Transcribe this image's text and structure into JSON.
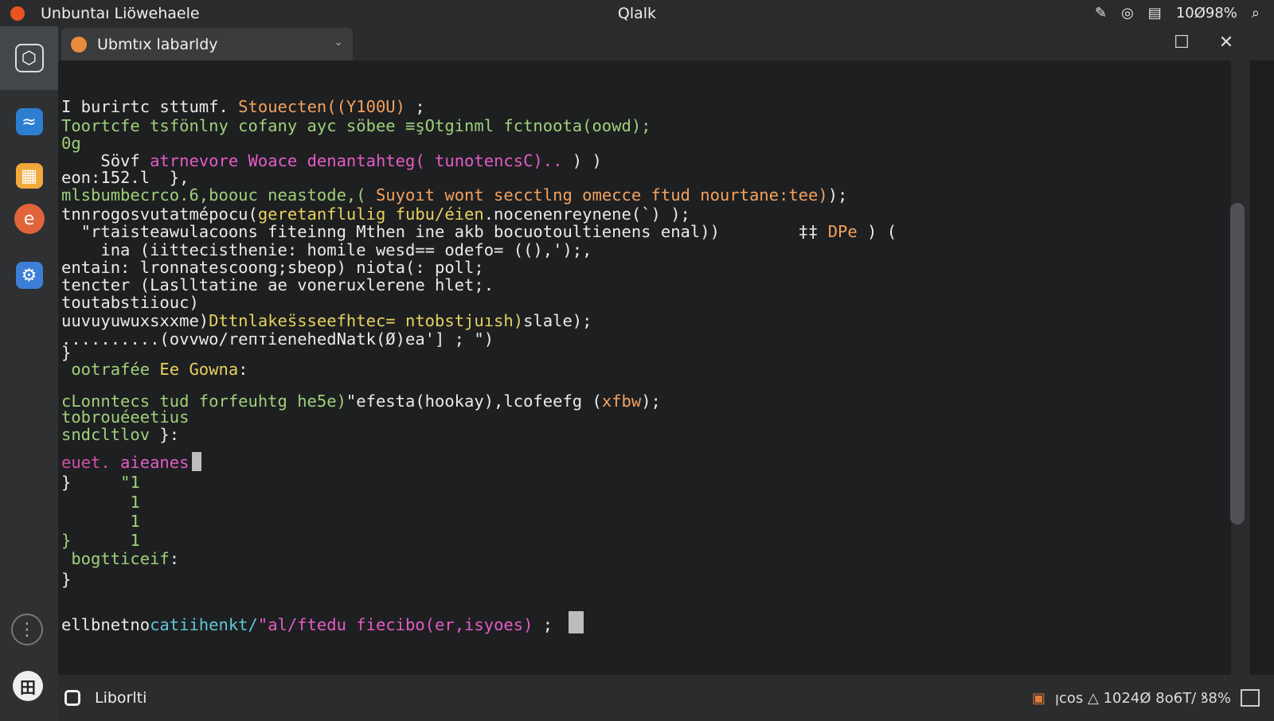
{
  "topbar": {
    "app_title": "Unbuntaı Liöwehaele",
    "clock": "Qlalk",
    "battery": "10Ø98%"
  },
  "tray_icons": [
    "edit-icon",
    "network-icon",
    "keyboard-icon",
    "search-icon"
  ],
  "dock": {
    "items": [
      "box-icon",
      "code-editor-icon",
      "files-icon",
      "browser-icon",
      "settings-icon"
    ],
    "more": "⋮",
    "apps": "田"
  },
  "window": {
    "tab_label": "Ubmtıx    labarldy",
    "maximize": "☐",
    "close": "✕"
  },
  "terminal": {
    "lines": [
      {
        "segs": [
          {
            "t": "I burirtc sttumf. ",
            "c": "#eaeaea"
          },
          {
            "t": "Stouecten((Y100U)",
            "c": "#f3a25e"
          },
          {
            "t": " ;",
            "c": "#eaeaea"
          }
        ]
      },
      {
        "segs": [
          {
            "t": "Toortcfe tsfönlny cofany ayc söbee ≡şOtginml fctnoota(oowd);",
            "c": "#9fd07a"
          }
        ]
      },
      {
        "segs": [
          {
            "t": "0g",
            "c": "#9fd07a"
          }
        ]
      },
      {
        "segs": [
          {
            "t": "    Sövf ",
            "c": "#eaeaea"
          },
          {
            "t": "atrnevore Woace denantahteg( tunotencsC)..",
            "c": "#e45cc4"
          },
          {
            "t": " ) )",
            "c": "#eaeaea"
          }
        ]
      },
      {
        "segs": [
          {
            "t": "eon:152.l  },",
            "c": "#eaeaea"
          }
        ]
      },
      {
        "segs": [
          {
            "t": "mlsbumbecrco.6,boouc neastode,( ",
            "c": "#9fd07a"
          },
          {
            "t": "Suyoıt wont secctlng omecce ftud nourtane:tee)",
            "c": "#f3a25e"
          },
          {
            "t": ");",
            "c": "#eaeaea"
          }
        ]
      },
      {
        "segs": [
          {
            "t": "tnnrogosvutatmépocu(",
            "c": "#eaeaea"
          },
          {
            "t": "geretanflulig fubu/éien",
            "c": "#e7d25d"
          },
          {
            "t": ".nocenenreynene(`) );",
            "c": "#eaeaea"
          }
        ]
      },
      {
        "segs": [
          {
            "t": "  \"rtaisteawulacoons fiteinng Mthen ine akb bocuotoultienens enal))",
            "c": "#eaeaea"
          },
          {
            "t": "        ‡‡ ",
            "c": "#eaeaea"
          },
          {
            "t": "DPe",
            "c": "#f3a25e"
          },
          {
            "t": " ) (",
            "c": "#eaeaea"
          }
        ]
      },
      {
        "segs": [
          {
            "t": "    ina (iittecisthenie: homile wesd== odefo= ((),');,",
            "c": "#eaeaea"
          }
        ]
      },
      {
        "segs": [
          {
            "t": "entain: lronnatescoong;sbeop) niota(: poll;",
            "c": "#eaeaea"
          }
        ]
      },
      {
        "segs": [
          {
            "t": "tencter (Laslltatine ae voneruxlerene hlet;.",
            "c": "#eaeaea"
          }
        ]
      },
      {
        "segs": [
          {
            "t": "toutabstiiouc)",
            "c": "#eaeaea"
          }
        ]
      },
      {
        "segs": [
          {
            "t": "uuvuyuwuxsxxme)",
            "c": "#eaeaea"
          },
          {
            "t": "Dttnlakes̈sseefhtec= ntobstjuısh)",
            "c": "#e7d25d"
          },
          {
            "t": "slale);",
            "c": "#eaeaea"
          }
        ]
      },
      {
        "segs": [
          {
            "t": "..........(ovvwo/rептienehedNatk(Ø)ea'] ; \")",
            "c": "#eaeaea"
          }
        ]
      },
      {
        "segs": [
          {
            "t": "}",
            "c": "#eaeaea"
          }
        ]
      },
      {
        "segs": [
          {
            "t": " ootrafée ",
            "c": "#9fd07a"
          },
          {
            "t": "Ee Gowna",
            "c": "#e7d25d"
          },
          {
            "t": ":",
            "c": "#eaeaea"
          }
        ]
      },
      {
        "segs": [
          {
            "t": "cLonntecs tud forfeuhtg he5e)",
            "c": "#9fd07a"
          },
          {
            "t": "\"efesta(hookay),lcofeefg (",
            "c": "#eaeaea"
          },
          {
            "t": "xfbw",
            "c": "#f3a25e"
          },
          {
            "t": ");",
            "c": "#eaeaea"
          }
        ]
      },
      {
        "segs": [
          {
            "t": "tobrouéeetius",
            "c": "#9fd07a"
          }
        ]
      },
      {
        "segs": [
          {
            "t": "sndcltlov",
            "c": "#9fd07a"
          },
          {
            "t": " }:",
            "c": "#eaeaea"
          }
        ]
      },
      {
        "segs": [
          {
            "t": "euet.",
            "c": "#d24ea8"
          },
          {
            "t": " aieanes",
            "c": "#e45cc4"
          }
        ],
        "cursor": true
      },
      {
        "segs": [
          {
            "t": "}     ",
            "c": "#eaeaea"
          },
          {
            "t": "\"1",
            "c": "#9fd07a"
          }
        ]
      },
      {
        "segs": [
          {
            "t": "       1",
            "c": "#9fd07a"
          }
        ]
      },
      {
        "segs": [
          {
            "t": "       1",
            "c": "#9fd07a"
          }
        ]
      },
      {
        "segs": [
          {
            "t": "}      1",
            "c": "#9fd07a"
          }
        ]
      },
      {
        "segs": [
          {
            "t": " bogtticeif",
            "c": "#9fd07a"
          },
          {
            "t": ":",
            "c": "#eaeaea"
          }
        ]
      },
      {
        "segs": [
          {
            "t": "}",
            "c": "#eaeaea"
          }
        ]
      },
      {
        "segs": [
          {
            "t": "ellbnetno",
            "c": "#eaeaea"
          },
          {
            "t": "catiihenkt/",
            "c": "#5fc7d8"
          },
          {
            "t": "\"al/ftedu ",
            "c": "#e45cc4"
          },
          {
            "t": "fiecibo(er,isyoes)",
            "c": "#e45cc4"
          },
          {
            "t": " ; ",
            "c": "#eaeaea"
          }
        ],
        "cursor": true
      }
    ]
  },
  "statusbar": {
    "label": "Liborlti",
    "tray_text": "ꞁcos  △ 1024Ø 8o6T/ ꝸ8%"
  }
}
